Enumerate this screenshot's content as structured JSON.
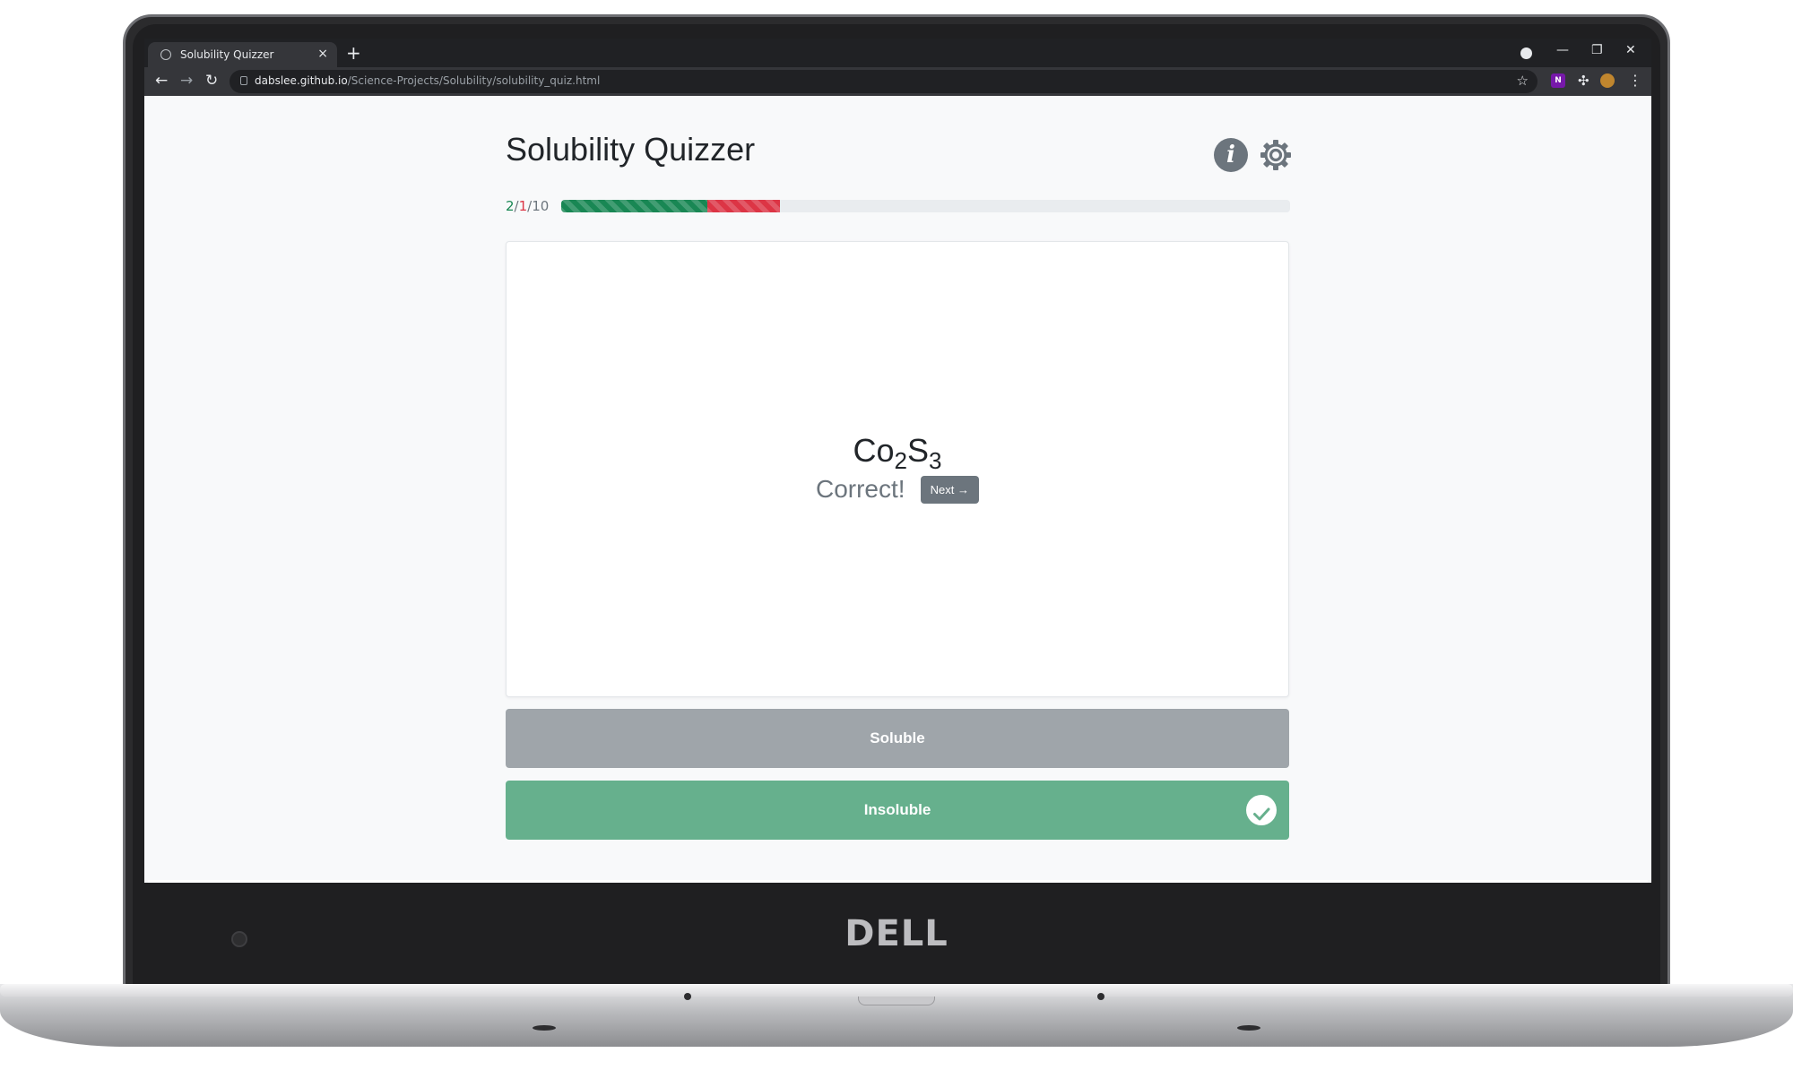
{
  "browser": {
    "tab_title": "Solubility Quizzer",
    "url_host": "dabslee.github.io",
    "url_path": "/Science-Projects/Solubility/solubility_quiz.html",
    "new_tab_label": "+",
    "extension_label": "N"
  },
  "app": {
    "title": "Solubility Quizzer",
    "info_label": "i"
  },
  "progress": {
    "correct": "2",
    "incorrect": "1",
    "total": "10",
    "correct_fraction": 0.2,
    "incorrect_fraction": 0.1
  },
  "question": {
    "formula_base1": "Co",
    "formula_sub1": "2",
    "formula_base2": "S",
    "formula_sub2": "3",
    "feedback": "Correct!",
    "next_label": "Next →"
  },
  "answers": {
    "soluble_label": "Soluble",
    "insoluble_label": "Insoluble",
    "selected": "Insoluble"
  },
  "device": {
    "brand": "DELL"
  },
  "colors": {
    "correct": "#198754",
    "incorrect": "#dc3545",
    "selected_answer": "#66b08d",
    "unselected_answer": "#9fa5aa"
  }
}
